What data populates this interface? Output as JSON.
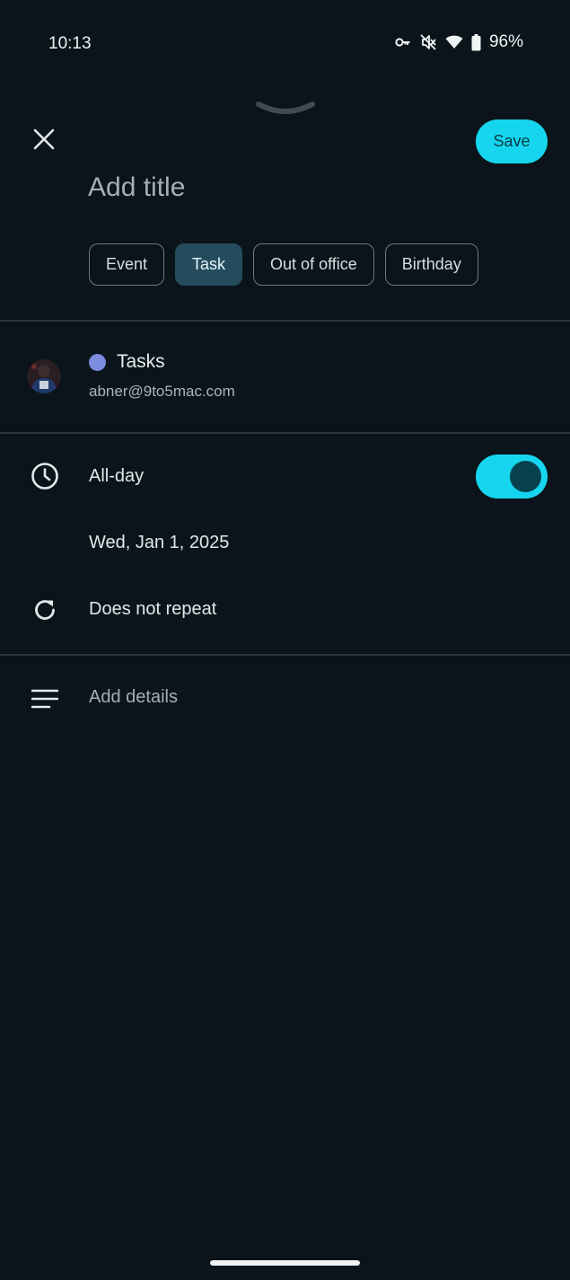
{
  "status_bar": {
    "time": "10:13",
    "battery_percent": "96%",
    "icons": [
      "vpn-key-icon",
      "silent-icon",
      "wifi-icon",
      "battery-icon"
    ]
  },
  "header": {
    "close_icon": "close-icon",
    "save_label": "Save",
    "title_placeholder": "Add title"
  },
  "type_chips": [
    {
      "label": "Event",
      "selected": false
    },
    {
      "label": "Task",
      "selected": true
    },
    {
      "label": "Out of office",
      "selected": false
    },
    {
      "label": "Birthday",
      "selected": false
    }
  ],
  "account": {
    "calendar_name": "Tasks",
    "calendar_color": "#7b8cde",
    "email": "abner@9to5mac.com"
  },
  "schedule": {
    "all_day_label": "All-day",
    "all_day_on": true,
    "date": "Wed, Jan 1, 2025",
    "repeat": "Does not repeat"
  },
  "details": {
    "placeholder": "Add details"
  },
  "colors": {
    "background": "#0a141a",
    "accent": "#15d6ee",
    "chip_selected": "#244c5c"
  }
}
